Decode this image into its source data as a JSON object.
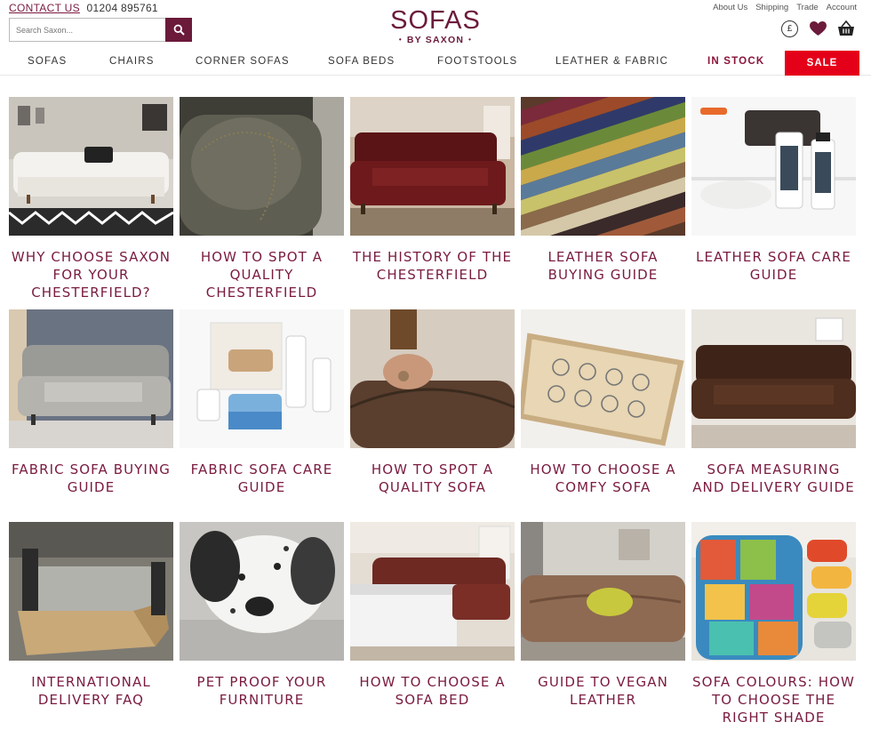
{
  "header": {
    "contact_label": "CONTACT US",
    "phone": "01204 895761",
    "search_placeholder": "Search Saxon...",
    "logo_main": "SOFAS",
    "logo_sub": "BY SAXON",
    "util_links": [
      "About Us",
      "Shipping",
      "Trade",
      "Account"
    ],
    "currency_symbol": "£",
    "icons": {
      "search": "search-icon",
      "currency": "currency-icon",
      "wishlist": "heart-icon",
      "basket": "basket-icon"
    },
    "brand_color": "#6b1a3a"
  },
  "nav": {
    "items": [
      "SOFAS",
      "CHAIRS",
      "CORNER SOFAS",
      "SOFA BEDS",
      "FOOTSTOOLS",
      "LEATHER & FABRIC",
      "IN STOCK"
    ],
    "sale": "SALE",
    "instock_color": "#8a1538",
    "sale_color": "#e50019"
  },
  "guides": [
    {
      "title": "WHY CHOOSE SAXON FOR YOUR CHESTERFIELD?"
    },
    {
      "title": "HOW TO SPOT A QUALITY CHESTERFIELD"
    },
    {
      "title": "THE HISTORY OF THE CHESTERFIELD"
    },
    {
      "title": "LEATHER SOFA BUYING GUIDE"
    },
    {
      "title": "LEATHER SOFA CARE GUIDE"
    },
    {
      "title": "FABRIC SOFA BUYING GUIDE"
    },
    {
      "title": "FABRIC SOFA CARE GUIDE"
    },
    {
      "title": "HOW TO SPOT A QUALITY SOFA"
    },
    {
      "title": "HOW TO CHOOSE A COMFY SOFA"
    },
    {
      "title": "SOFA MEASURING AND DELIVERY GUIDE"
    },
    {
      "title": "INTERNATIONAL DELIVERY FAQ"
    },
    {
      "title": "PET PROOF YOUR FURNITURE"
    },
    {
      "title": "HOW TO CHOOSE A SOFA BED"
    },
    {
      "title": "GUIDE TO VEGAN LEATHER"
    },
    {
      "title": "SOFA COLOURS: HOW TO CHOOSE THE RIGHT SHADE"
    }
  ]
}
